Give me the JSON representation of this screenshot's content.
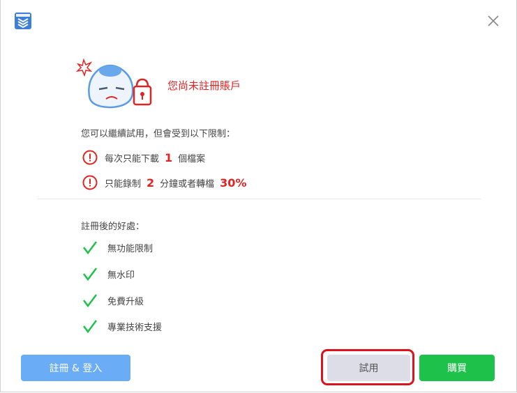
{
  "dialog": {
    "title": "您尚未註冊賬戶",
    "intro": "您可以繼續試用，但會受到以下限制：",
    "limitations": [
      {
        "prefix": "每次只能下載",
        "number": "1",
        "suffix": "個檔案",
        "percent": ""
      },
      {
        "prefix": "只能錄制",
        "number": "2",
        "suffix": "分鐘或者轉檔",
        "percent": "30%"
      }
    ],
    "benefits_title": "註冊後的好處：",
    "benefits": [
      "無功能限制",
      "無水印",
      "免費升級",
      "專業技術支援"
    ]
  },
  "buttons": {
    "register": "註冊 & 登入",
    "trial": "試用",
    "buy": "購買"
  },
  "icons": {
    "app": "app-logo-icon",
    "close": "close-icon",
    "mascot": "sad-mascot-lock-icon",
    "limit": "exclamation-circle-icon",
    "benefit": "checkmark-icon"
  },
  "colors": {
    "warning_red": "#e02424",
    "check_green": "#1ec24b",
    "register_blue": "#6aacf6",
    "trial_gray": "#dcdde6",
    "buy_green": "#1ec24b",
    "highlight_red": "#d9141c"
  }
}
